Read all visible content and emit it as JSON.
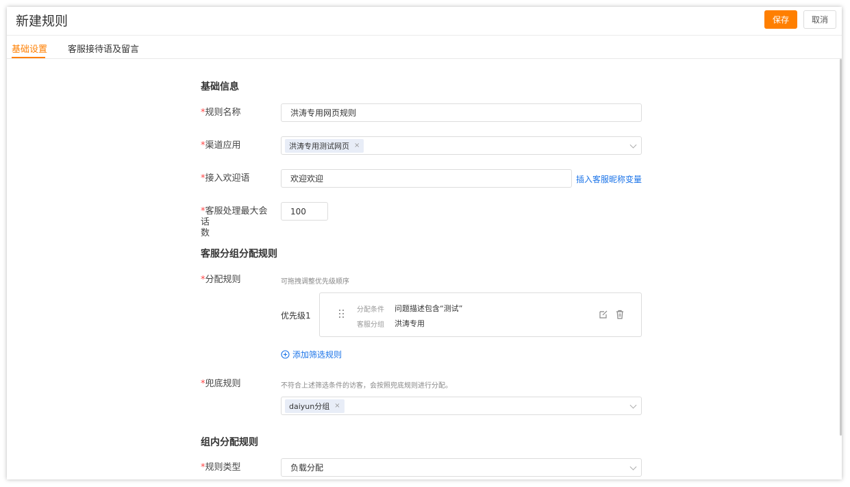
{
  "header": {
    "title": "新建规则",
    "save_label": "保存",
    "cancel_label": "取消"
  },
  "tabs": [
    {
      "label": "基础设置",
      "active": true
    },
    {
      "label": "客服接待语及留言",
      "active": false
    }
  ],
  "basic_info": {
    "section_title": "基础信息",
    "rule_name": {
      "required": "*",
      "label": "规则名称",
      "value": "洪涛专用网页规则"
    },
    "channel": {
      "required": "*",
      "label": "渠道应用",
      "tag": "洪涛专用测试网页",
      "remove": "×"
    },
    "welcome": {
      "required": "*",
      "label": "接入欢迎语",
      "value": "欢迎欢迎",
      "insert_link": "插入客服昵称变量"
    },
    "max_sessions": {
      "required": "*",
      "label_line1": "客服处理最大会话",
      "label_line2": "数",
      "value": "100"
    }
  },
  "group_rules": {
    "section_title": "客服分组分配规则",
    "assign": {
      "required": "*",
      "label": "分配规则",
      "hint": "可拖拽调整优先级顺序",
      "priority_label": "优先级1",
      "condition_key": "分配条件",
      "condition_value": "问题描述包含“测试”",
      "group_key": "客服分组",
      "group_value": "洪涛专用",
      "add_filter": "添加筛选规则"
    },
    "fallback": {
      "required": "*",
      "label": "兜底规则",
      "hint": "不符合上述筛选条件的访客，会按照兜底规则进行分配。",
      "tag": "daiyun分组",
      "remove": "×"
    }
  },
  "intra_group": {
    "section_title": "组内分配规则",
    "rule_type": {
      "required": "*",
      "label": "规则类型",
      "value": "负载分配"
    }
  },
  "colors": {
    "accent": "#ff7f00",
    "link": "#1a73e8",
    "required": "#ff4444",
    "tag_bg": "#e8edf7"
  }
}
